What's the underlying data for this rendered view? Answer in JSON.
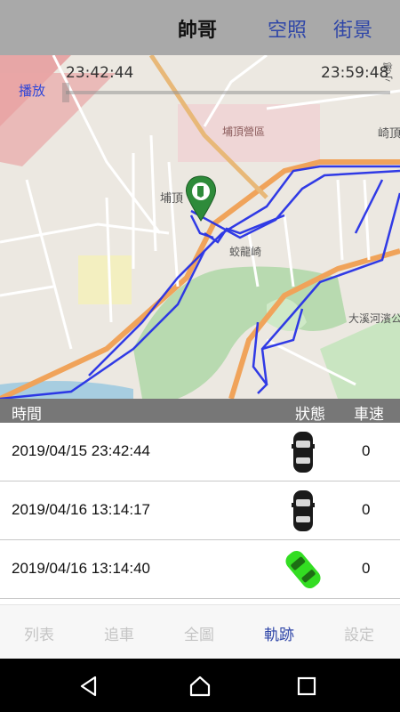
{
  "header": {
    "title": "帥哥",
    "aerial_label": "空照",
    "street_label": "街景"
  },
  "player": {
    "play_label": "播放",
    "start_time": "23:42:44",
    "end_time": "23:59:48",
    "progress": 0
  },
  "map": {
    "labels": {
      "district_office": "埔頂營區",
      "neighborhood_buding": "埔頂",
      "neighborhood_jiaolong": "蛟龍崎",
      "park": "大溪河濱公園",
      "qidin": "崎頂",
      "xiaoguan": "小瑯"
    },
    "colors": {
      "track": "#2631e6",
      "main_road": "#f0a35a",
      "green": "#b8dab0",
      "water": "#a7cde0"
    }
  },
  "table": {
    "columns": {
      "time": "時間",
      "status": "狀態",
      "speed": "車速"
    },
    "rows": [
      {
        "datetime": "2019/04/15 23:42:44",
        "status_icon": "car-black-icon",
        "speed": "0"
      },
      {
        "datetime": "2019/04/16 13:14:17",
        "status_icon": "car-black-icon",
        "speed": "0"
      },
      {
        "datetime": "2019/04/16 13:14:40",
        "status_icon": "car-green-icon",
        "speed": "0"
      }
    ]
  },
  "tabs": [
    {
      "label": "列表",
      "active": false
    },
    {
      "label": "追車",
      "active": false
    },
    {
      "label": "全圖",
      "active": false
    },
    {
      "label": "軌跡",
      "active": true
    },
    {
      "label": "設定",
      "active": false
    }
  ],
  "system_nav": {
    "back": "back-icon",
    "home": "home-icon",
    "recents": "recents-icon"
  }
}
